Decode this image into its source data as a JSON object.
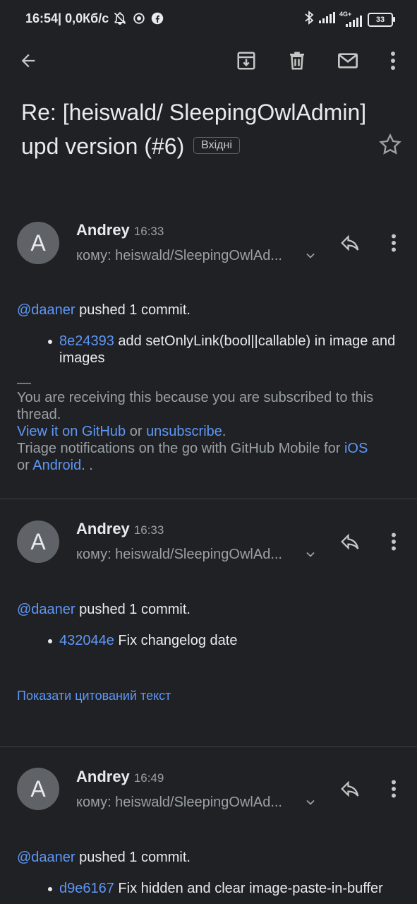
{
  "status_bar": {
    "time": "16:54",
    "network_speed": "| 0,0Кб/с",
    "battery": "33",
    "network_label": "4G+"
  },
  "toolbar": {
    "icons": [
      "back-arrow-icon",
      "archive-icon",
      "delete-icon",
      "mark-unread-icon",
      "more-vert-icon"
    ]
  },
  "subject": {
    "text": "Re: [heiswald/ SleepingOwlAdmin] upd version (#6)",
    "label": "Вхідні"
  },
  "messages": [
    {
      "avatar_letter": "A",
      "sender": "Andrey",
      "time": "16:33",
      "to": "кому: heiswald/SleepingOwlAd...",
      "actor": "@daaner",
      "action": " pushed 1 commit.",
      "commit_hash": "8e24393",
      "commit_msg": " add setOnlyLink(bool||callable) in image and images",
      "separator": "—",
      "footer_line1": "You are receiving this because you are subscribed to this thread.",
      "footer_view": "View it on GitHub",
      "footer_or": " or ",
      "footer_unsub": "unsubscribe",
      "footer_dot": ".",
      "footer_triage": "Triage notifications on the go with GitHub Mobile for ",
      "footer_ios": "iOS",
      "footer_or2": "or ",
      "footer_android": "Android",
      "footer_end": ". ."
    },
    {
      "avatar_letter": "A",
      "sender": "Andrey",
      "time": "16:33",
      "to": "кому: heiswald/SleepingOwlAd...",
      "actor": "@daaner",
      "action": " pushed 1 commit.",
      "commit_hash": "432044e",
      "commit_msg": " Fix changelog date",
      "show_quoted": "Показати цитований текст"
    },
    {
      "avatar_letter": "A",
      "sender": "Andrey",
      "time": "16:49",
      "to": "кому: heiswald/SleepingOwlAd...",
      "actor": "@daaner",
      "action": " pushed 1 commit.",
      "commit_hash": "d9e6167",
      "commit_msg": " Fix hidden and clear image-paste-in-buffer"
    }
  ],
  "colors": {
    "background": "#202124",
    "text": "#e8eaed",
    "muted": "#9aa0a6",
    "link": "#5e97f6",
    "avatar": "#5f6368"
  }
}
